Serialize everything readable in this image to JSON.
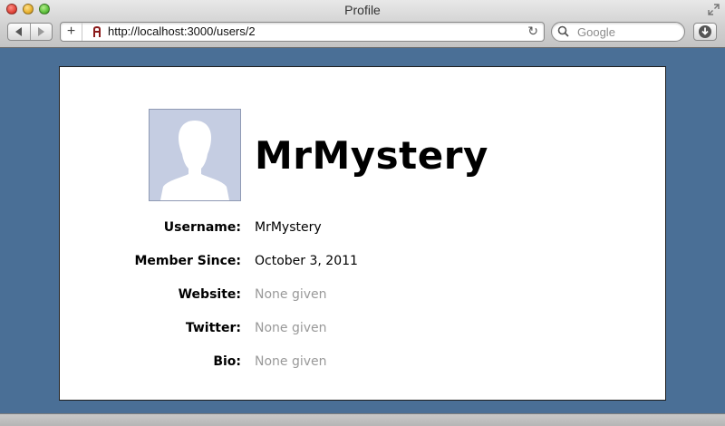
{
  "window": {
    "title": "Profile"
  },
  "toolbar": {
    "url": "http://localhost:3000/users/2",
    "search_placeholder": "Google",
    "new_tab_label": "+"
  },
  "profile": {
    "name": "MrMystery",
    "fields": [
      {
        "label": "Username:",
        "value": "MrMystery",
        "muted": false
      },
      {
        "label": "Member Since:",
        "value": "October 3, 2011",
        "muted": false
      },
      {
        "label": "Website:",
        "value": "None given",
        "muted": true
      },
      {
        "label": "Twitter:",
        "value": "None given",
        "muted": true
      },
      {
        "label": "Bio:",
        "value": "None given",
        "muted": true
      }
    ]
  },
  "icons": {
    "back": "chevron-left-icon",
    "forward": "chevron-right-icon",
    "reload": "reload-icon",
    "search": "search-icon",
    "download": "download-icon",
    "avatar": "default-avatar-silhouette"
  },
  "colors": {
    "page_background": "#4a6f96",
    "avatar_background": "#c5cde2",
    "muted_text": "#999999"
  }
}
